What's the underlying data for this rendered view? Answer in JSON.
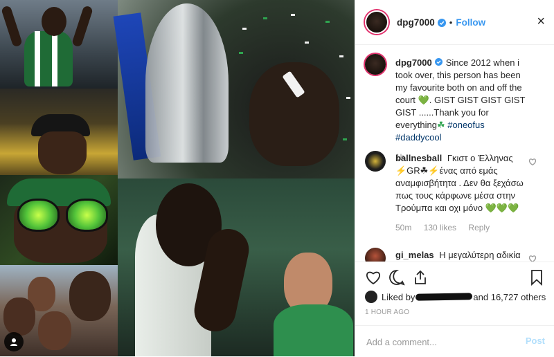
{
  "post": {
    "author": "dpg7000",
    "follow_label": "Follow",
    "close_symbol": "×",
    "verified_icon": "verified-badge-icon",
    "accent_color": "#3897f0"
  },
  "caption": {
    "username": "dpg7000",
    "text": "Since 2012 when i took over, this person has been my favourite both on and off the court",
    "emoji_heart": "💚",
    "text2": ". GIST GIST GIST GIST GIST ......Thank you for everything",
    "emoji_shamrock": "☘",
    "hashtags": [
      "#oneofus",
      "#daddycool"
    ],
    "time": "1h"
  },
  "comments": [
    {
      "username": "ballnesball",
      "text": "Γκιστ ο Έλληνας ⚡GR☘⚡ένας από εμάς αναμφισβήτητα . Δεν θα ξεχάσω πως τους κάρφωνε μέσα στην Τρούμπα και οχι μόνο 💚💚💚",
      "time": "50m",
      "likes": "130 likes",
      "reply": "Reply"
    },
    {
      "username": "gi_melas",
      "text": "Η μεγαλύτερη αδικία"
    }
  ],
  "actions": {
    "like_icon": "heart-icon",
    "comment_icon": "comment-icon",
    "share_icon": "share-icon",
    "save_icon": "bookmark-icon"
  },
  "likes": {
    "prefix": "Liked by",
    "suffix": "and 16,727 others"
  },
  "timestamp": "1 HOUR AGO",
  "add_comment": {
    "placeholder": "Add a comment...",
    "post_label": "Post"
  }
}
